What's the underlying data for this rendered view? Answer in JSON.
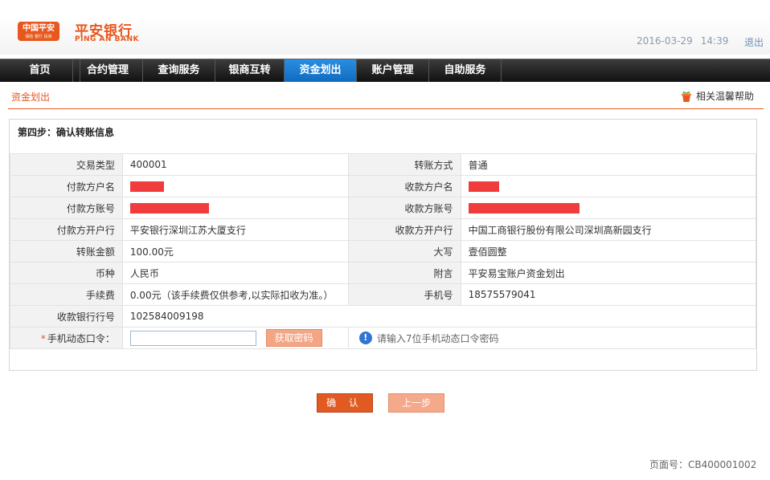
{
  "header": {
    "logo_text": "中国平安",
    "logo_sub": "保险 银行 投资",
    "brand_cn": "平安银行",
    "brand_en": "PING AN BANK",
    "date": "2016-03-29",
    "time": "14:39",
    "logout_label": "退出",
    "brand_color": "#e8571e"
  },
  "nav": {
    "items": [
      "首页",
      "合约管理",
      "查询服务",
      "银商互转",
      "资金划出",
      "账户管理",
      "自助服务"
    ],
    "active": "资金划出",
    "active_color": "#1a7fd4"
  },
  "section": {
    "title": "资金划出",
    "help_label": "相关温馨帮助",
    "help_icon": "gift-basket-icon"
  },
  "form": {
    "step_title": "第四步：确认转账信息",
    "rows": [
      {
        "l1": "交易类型",
        "v1": "400001",
        "l2": "转账方式",
        "v2": "普通"
      },
      {
        "l1": "付款方户名",
        "v1": "",
        "l2": "收款方户名",
        "v2": ""
      },
      {
        "l1": "付款方账号",
        "v1": "",
        "l2": "收款方账号",
        "v2": ""
      },
      {
        "l1": "付款方开户行",
        "v1": "平安银行深圳江苏大厦支行",
        "l2": "收款方开户行",
        "v2": "中国工商银行股份有限公司深圳高新园支行"
      },
      {
        "l1": "转账金额",
        "v1": "100.00元",
        "l2": "大写",
        "v2": "壹佰圆整"
      },
      {
        "l1": "币种",
        "v1": "人民币",
        "l2": "附言",
        "v2": "平安易宝账户资金划出"
      },
      {
        "l1": "手续费",
        "v1": "0.00元（该手续费仅供参考,以实际扣收为准。）",
        "l2": "手机号",
        "v2": "18575579041"
      },
      {
        "l1": "收款银行行号",
        "v1": "102584009198"
      }
    ],
    "otp_label": "手机动态口令：",
    "otp_required_mark": "*",
    "otp_value": "",
    "otp_button": "获取密码",
    "otp_hint": "请输入7位手机动态口令密码",
    "redaction_color": "#f03c3c"
  },
  "buttons": {
    "confirm": "确 认",
    "previous": "上一步"
  },
  "footer": {
    "page_no": "页面号：CB400001002"
  }
}
